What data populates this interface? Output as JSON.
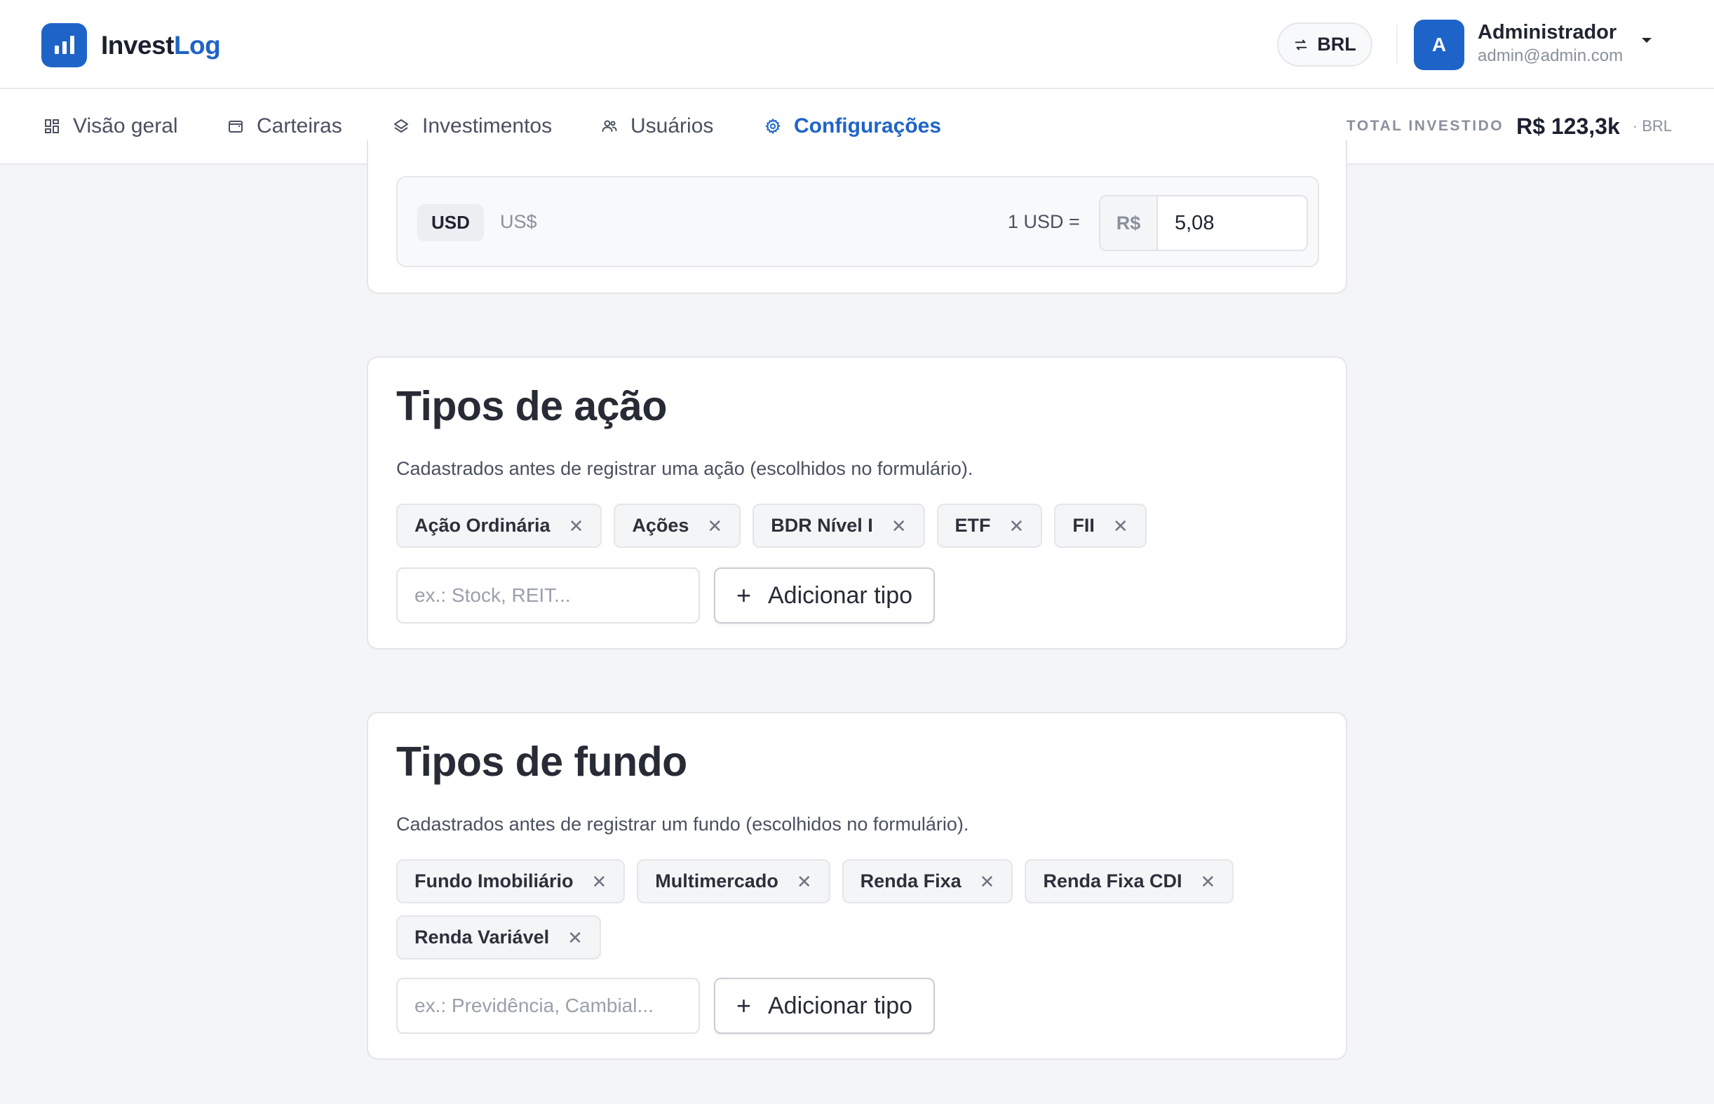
{
  "brand": {
    "name_main": "Invest",
    "name_accent": "Log"
  },
  "header": {
    "currency": "BRL",
    "user": {
      "initial": "A",
      "name": "Administrador",
      "email": "admin@admin.com"
    }
  },
  "nav": {
    "items": [
      {
        "label": "Visão geral",
        "icon": "dashboard-grid-icon"
      },
      {
        "label": "Carteiras",
        "icon": "wallet-icon"
      },
      {
        "label": "Investimentos",
        "icon": "layers-icon"
      },
      {
        "label": "Usuários",
        "icon": "users-icon"
      },
      {
        "label": "Configurações",
        "icon": "gear-icon",
        "active": true
      }
    ],
    "total_label": "TOTAL INVESTIDO",
    "total_value": "R$ 123,3k",
    "total_currency": "· BRL"
  },
  "currency_rate": {
    "code": "USD",
    "symbol": "US$",
    "equation": "1 USD =",
    "prefix": "R$",
    "value": "5,08"
  },
  "stock_types": {
    "title": "Tipos de ação",
    "description": "Cadastrados antes de registrar uma ação (escolhidos no formulário).",
    "chips": [
      "Ação Ordinária",
      "Ações",
      "BDR Nível I",
      "ETF",
      "FII"
    ],
    "placeholder": "ex.: Stock, REIT...",
    "add_label": "Adicionar tipo"
  },
  "fund_types": {
    "title": "Tipos de fundo",
    "description": "Cadastrados antes de registrar um fundo (escolhidos no formulário).",
    "chips": [
      "Fundo Imobiliário",
      "Multimercado",
      "Renda Fixa",
      "Renda Fixa CDI",
      "Renda Variável"
    ],
    "placeholder": "ex.: Previdência, Cambial...",
    "add_label": "Adicionar tipo"
  },
  "colors": {
    "accent": "#1e64c8",
    "background": "#f4f5f7",
    "muted": "#8a909c"
  }
}
